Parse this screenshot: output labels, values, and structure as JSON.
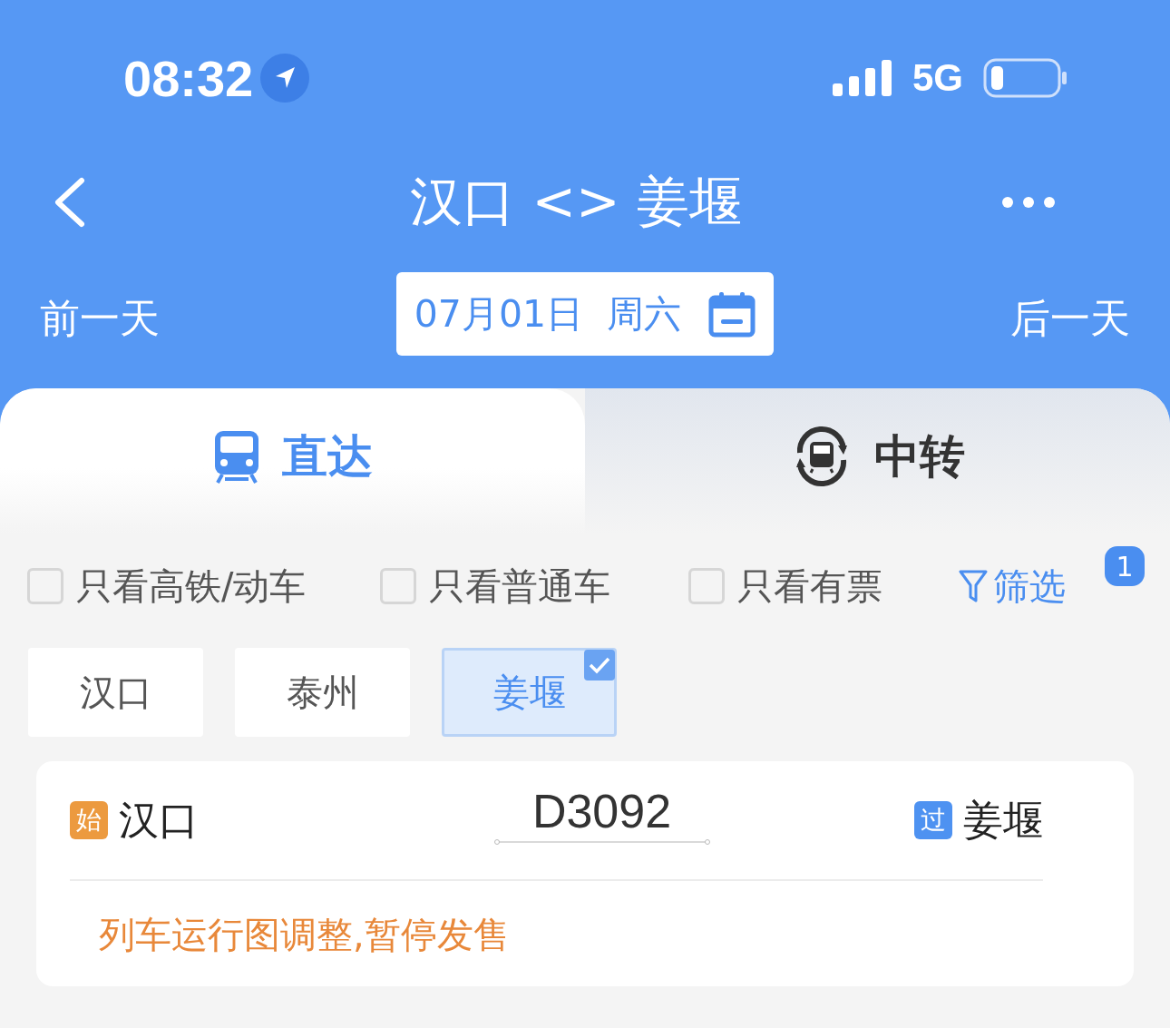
{
  "status_bar": {
    "time": "08:32",
    "network": "5G"
  },
  "nav": {
    "title": "汉口 <> 姜堰"
  },
  "date_bar": {
    "prev": "前一天",
    "date": "07月01日  周六",
    "next": "后一天"
  },
  "tabs": [
    {
      "kind": "direct",
      "label": "直达",
      "selected": true
    },
    {
      "kind": "transfer",
      "label": "中转",
      "selected": false
    }
  ],
  "filters": [
    {
      "label": "只看高铁/动车",
      "checked": false
    },
    {
      "label": "只看普通车",
      "checked": false
    },
    {
      "label": "只看有票",
      "checked": false
    }
  ],
  "filter_button": {
    "label": "筛选",
    "badge": "1"
  },
  "stations": [
    {
      "label": "汉口",
      "selected": false
    },
    {
      "label": "泰州",
      "selected": false
    },
    {
      "label": "姜堰",
      "selected": true
    }
  ],
  "trains": [
    {
      "from_tag": {
        "text": "始",
        "color": "#ec9a3f"
      },
      "from": "汉口",
      "number": "D3092",
      "to_tag": {
        "text": "过",
        "color": "#4e92f1"
      },
      "to": "姜堰",
      "notice": "列车运行图调整,暂停发售"
    }
  ]
}
